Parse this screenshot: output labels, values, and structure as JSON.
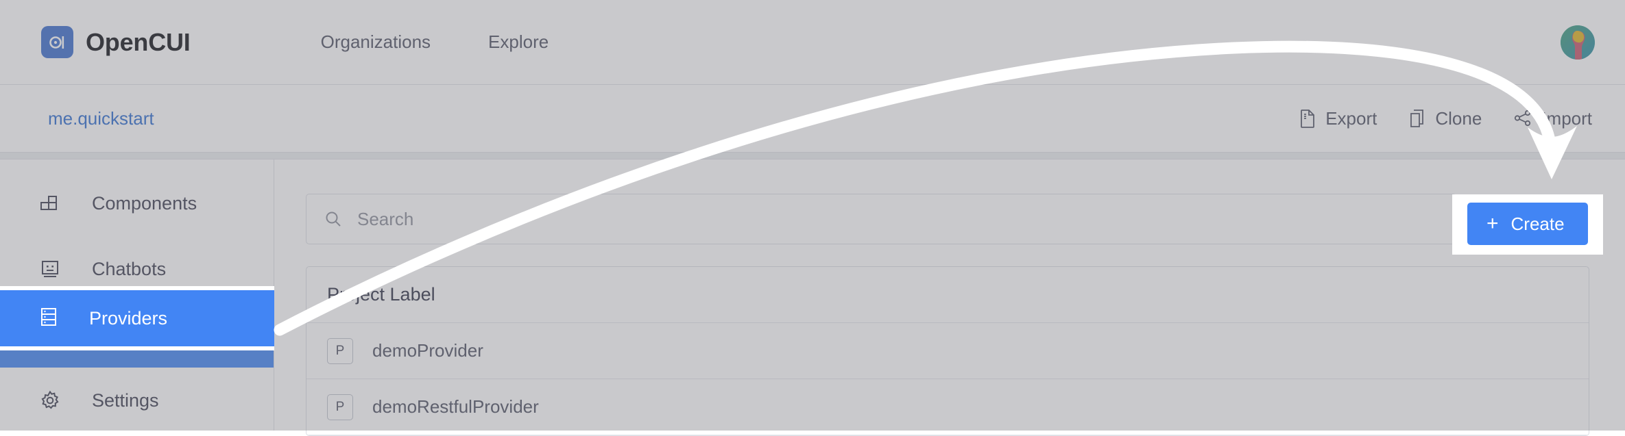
{
  "app": {
    "brand_name": "OpenCUI",
    "logo_mark": "ci-logo-icon"
  },
  "topnav": {
    "items": [
      {
        "label": "Organizations",
        "icon": ""
      },
      {
        "label": "Explore",
        "icon": ""
      }
    ],
    "avatar_icon": "user-avatar"
  },
  "subbar": {
    "breadcrumb": "me.quickstart",
    "actions": [
      {
        "label": "Export",
        "icon": "file-export-icon"
      },
      {
        "label": "Clone",
        "icon": "copy-icon"
      },
      {
        "label": "Import",
        "icon": "share-import-icon"
      }
    ]
  },
  "sidebar": {
    "items": [
      {
        "label": "Components",
        "icon": "blocks-icon",
        "active": false
      },
      {
        "label": "Chatbots",
        "icon": "robot-face-icon",
        "active": false
      },
      {
        "label": "Providers",
        "icon": "server-stack-icon",
        "active": true
      },
      {
        "label": "Settings",
        "icon": "gear-icon",
        "active": false
      }
    ]
  },
  "main": {
    "search": {
      "value": "",
      "placeholder": "Search",
      "icon": "search-icon"
    },
    "create_button": {
      "label": "Create",
      "plus": "+",
      "color": "#4285f4"
    },
    "table": {
      "columns": [
        "Project Label"
      ],
      "rows": [
        {
          "badge": "P",
          "label": "demoProvider"
        },
        {
          "badge": "P",
          "label": "demoRestfulProvider"
        }
      ]
    }
  },
  "annotation": {
    "arrow_color": "#ffffff",
    "highlight_color": "#ffffff",
    "description": "curved arrow from Providers sidebar item to Create button"
  },
  "colors": {
    "accent": "#4285f4",
    "link": "#2f6fd0",
    "text": "#3d3f50",
    "muted": "#8b8e99",
    "border": "#dcdfe5",
    "dim_overlay": "rgba(120,120,128,0.40)"
  }
}
